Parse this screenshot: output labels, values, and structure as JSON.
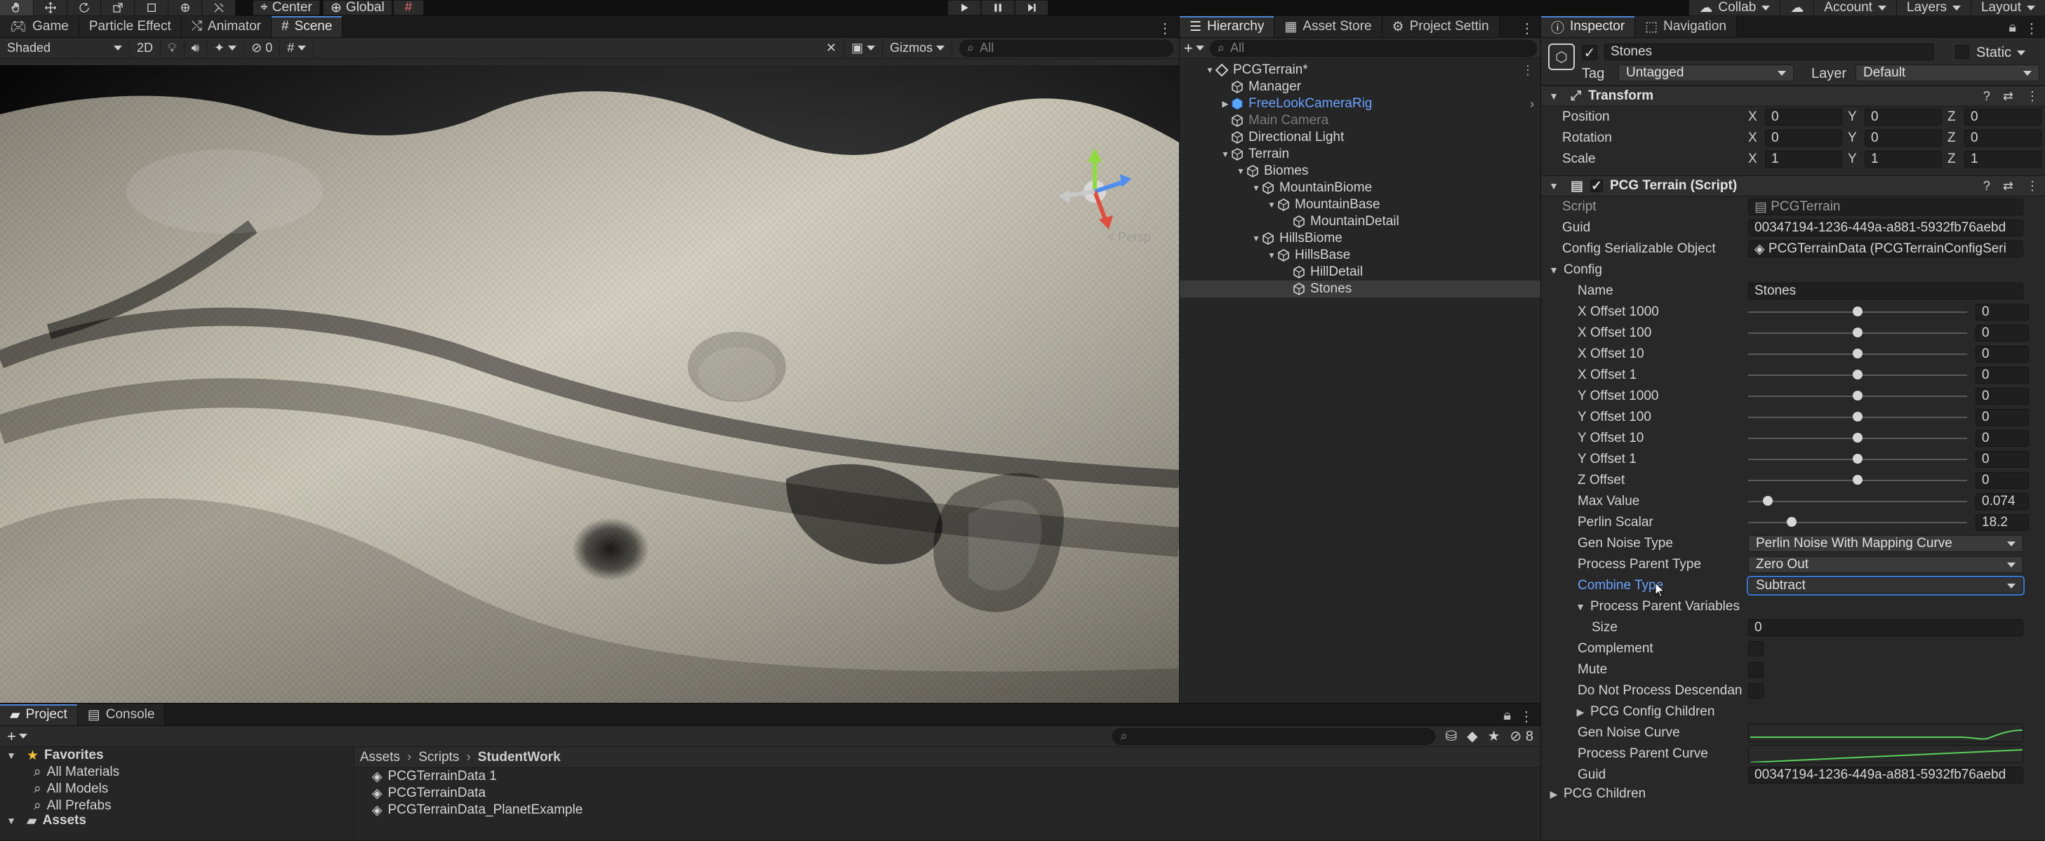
{
  "toolbar": {
    "pivot": "Center",
    "space": "Global",
    "collab": "Collab",
    "account": "Account",
    "layers": "Layers",
    "layout": "Layout"
  },
  "scene": {
    "tabs": [
      "Game",
      "Particle Effect",
      "Animator",
      "Scene"
    ],
    "active_tab": "Scene",
    "shading_mode": "Shaded",
    "mode_2d": "2D",
    "hidden_count": "0",
    "gizmos": "Gizmos",
    "search_placeholder": "All",
    "persp_label": "< Persp"
  },
  "hierarchy": {
    "tabs": [
      "Hierarchy",
      "Asset Store",
      "Project Settin"
    ],
    "search_placeholder": "All",
    "items": [
      {
        "label": "PCGTerrain*",
        "depth": 0,
        "expanded": true,
        "kind": "scene"
      },
      {
        "label": "Manager",
        "depth": 1,
        "kind": "cube"
      },
      {
        "label": "FreeLookCameraRig",
        "depth": 1,
        "expanded": false,
        "kind": "prefab"
      },
      {
        "label": "Main Camera",
        "depth": 1,
        "kind": "cube",
        "dim": true
      },
      {
        "label": "Directional Light",
        "depth": 1,
        "kind": "cube"
      },
      {
        "label": "Terrain",
        "depth": 1,
        "expanded": true,
        "kind": "cube"
      },
      {
        "label": "Biomes",
        "depth": 2,
        "expanded": true,
        "kind": "cube"
      },
      {
        "label": "MountainBiome",
        "depth": 3,
        "expanded": true,
        "kind": "cube"
      },
      {
        "label": "MountainBase",
        "depth": 4,
        "expanded": true,
        "kind": "cube"
      },
      {
        "label": "MountainDetail",
        "depth": 5,
        "kind": "cube"
      },
      {
        "label": "HillsBiome",
        "depth": 3,
        "expanded": true,
        "kind": "cube"
      },
      {
        "label": "HillsBase",
        "depth": 4,
        "expanded": true,
        "kind": "cube"
      },
      {
        "label": "HillDetail",
        "depth": 5,
        "kind": "cube"
      },
      {
        "label": "Stones",
        "depth": 5,
        "kind": "cube",
        "selected": true
      }
    ]
  },
  "inspector": {
    "tabs": [
      "Inspector",
      "Navigation"
    ],
    "object_name": "Stones",
    "static_label": "Static",
    "tag_label": "Tag",
    "tag_value": "Untagged",
    "layer_label": "Layer",
    "layer_value": "Default",
    "transform": {
      "title": "Transform",
      "rows": [
        {
          "label": "Position",
          "x": "0",
          "y": "0",
          "z": "0"
        },
        {
          "label": "Rotation",
          "x": "0",
          "y": "0",
          "z": "0"
        },
        {
          "label": "Scale",
          "x": "1",
          "y": "1",
          "z": "1"
        }
      ]
    },
    "script_component": {
      "title": "PCG Terrain (Script)",
      "script_label": "Script",
      "script_value": "PCGTerrain",
      "guid_label": "Guid",
      "guid_value": "00347194-1236-449a-a881-5932fb76aebd",
      "config_obj_label": "Config Serializable Object",
      "config_obj_value": "PCGTerrainData (PCGTerrainConfigSeri",
      "config_label": "Config",
      "name_label": "Name",
      "name_value": "Stones",
      "sliders": [
        {
          "label": "X Offset 1000",
          "value": "0",
          "pos": 0.5
        },
        {
          "label": "X Offset 100",
          "value": "0",
          "pos": 0.5
        },
        {
          "label": "X Offset 10",
          "value": "0",
          "pos": 0.5
        },
        {
          "label": "X Offset 1",
          "value": "0",
          "pos": 0.5
        },
        {
          "label": "Y Offset 1000",
          "value": "0",
          "pos": 0.5
        },
        {
          "label": "Y Offset 100",
          "value": "0",
          "pos": 0.5
        },
        {
          "label": "Y Offset 10",
          "value": "0",
          "pos": 0.5
        },
        {
          "label": "Y Offset 1",
          "value": "0",
          "pos": 0.5
        },
        {
          "label": "Z Offset",
          "value": "0",
          "pos": 0.5
        },
        {
          "label": "Max Value",
          "value": "0.074",
          "pos": 0.09
        },
        {
          "label": "Perlin Scalar",
          "value": "18.2",
          "pos": 0.2
        }
      ],
      "gen_noise_label": "Gen Noise Type",
      "gen_noise_value": "Perlin Noise With Mapping Curve",
      "process_parent_label": "Process Parent Type",
      "process_parent_value": "Zero Out",
      "combine_label": "Combine Type",
      "combine_value": "Subtract",
      "ppv_label": "Process Parent Variables",
      "size_label": "Size",
      "size_value": "0",
      "complement_label": "Complement",
      "mute_label": "Mute",
      "dnpd_label": "Do Not Process Descendan",
      "children_label": "PCG Config Children",
      "gen_curve_label": "Gen Noise Curve",
      "process_curve_label": "Process Parent Curve",
      "guid2_label": "Guid",
      "guid2_value": "00347194-1236-449a-a881-5932fb76aebd",
      "pcg_children_label": "PCG Children"
    }
  },
  "project": {
    "tabs": [
      "Project",
      "Console"
    ],
    "hidden_count": "8",
    "favorites_label": "Favorites",
    "favorites": [
      "All Materials",
      "All Models",
      "All Prefabs"
    ],
    "assets_label": "Assets",
    "breadcrumb": [
      "Assets",
      "Scripts",
      "StudentWork"
    ],
    "files": [
      "PCGTerrainData 1",
      "PCGTerrainData",
      "PCGTerrainData_PlanetExample"
    ]
  }
}
